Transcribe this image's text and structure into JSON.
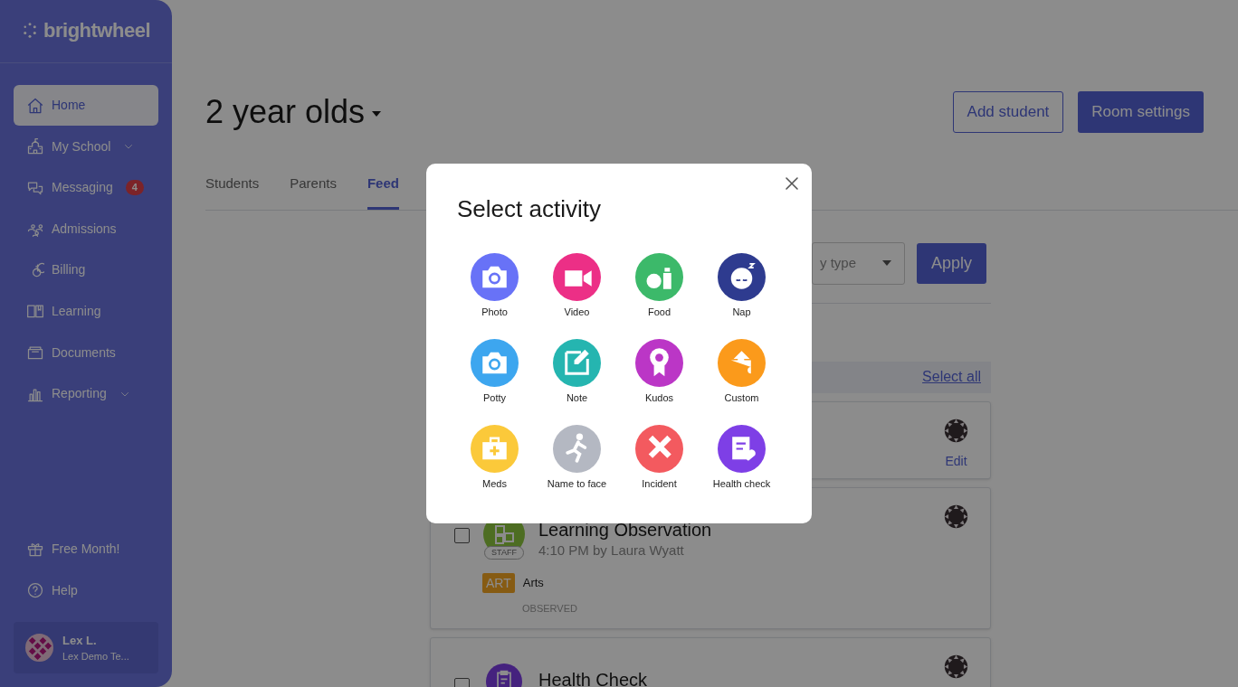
{
  "sidebar": {
    "logo": "brightwheel",
    "items": [
      {
        "label": "Home",
        "selected": true
      },
      {
        "label": "My School",
        "selected": false,
        "submenu": true
      },
      {
        "label": "Messaging",
        "selected": false,
        "badge": "4"
      },
      {
        "label": "Admissions",
        "selected": false
      },
      {
        "label": "Billing",
        "selected": false
      },
      {
        "label": "Learning",
        "selected": false
      },
      {
        "label": "Documents",
        "selected": false
      },
      {
        "label": "Reporting",
        "selected": false,
        "submenu": true
      }
    ],
    "footer_items": [
      {
        "label": "Free Month!"
      },
      {
        "label": "Help"
      }
    ],
    "user": {
      "name": "Lex L.",
      "school": "Lex Demo Te..."
    }
  },
  "header": {
    "title": "2 year olds",
    "buttons": [
      "Add student",
      "Room settings"
    ]
  },
  "tabs": [
    {
      "label": "Students",
      "selected": false
    },
    {
      "label": "Parents",
      "selected": false
    },
    {
      "label": "Feed",
      "selected": true
    }
  ],
  "filter": {
    "dropdown_text": "y type",
    "apply": "Apply"
  },
  "select_all": "Select all",
  "feed": [
    {
      "kind": "partial",
      "action": "Edit"
    },
    {
      "kind": "full",
      "checked": false,
      "title": "Learning Observation",
      "subtitle": "4:10 PM by Laura Wyatt",
      "badge": "STAFF",
      "tag": "ART",
      "tag_label": "Arts",
      "status": "OBSERVED"
    },
    {
      "kind": "full",
      "checked": false,
      "title": "Health Check"
    }
  ],
  "modal": {
    "title": "Select activity",
    "activities": [
      {
        "label": "Photo",
        "color": "#6872f7"
      },
      {
        "label": "Video",
        "color": "#ec2f86"
      },
      {
        "label": "Food",
        "color": "#3cb96a"
      },
      {
        "label": "Nap",
        "color": "#2e3b8f"
      },
      {
        "label": "Potty",
        "color": "#3da6ef"
      },
      {
        "label": "Note",
        "color": "#25b5b0"
      },
      {
        "label": "Kudos",
        "color": "#bb36c6"
      },
      {
        "label": "Custom",
        "color": "#fb9a1b"
      },
      {
        "label": "Meds",
        "color": "#fbc93a"
      },
      {
        "label": "Name to face",
        "color": "#b4b8c2"
      },
      {
        "label": "Incident",
        "color": "#f35a5f"
      },
      {
        "label": "Health check",
        "color": "#7e3fe6"
      }
    ]
  }
}
